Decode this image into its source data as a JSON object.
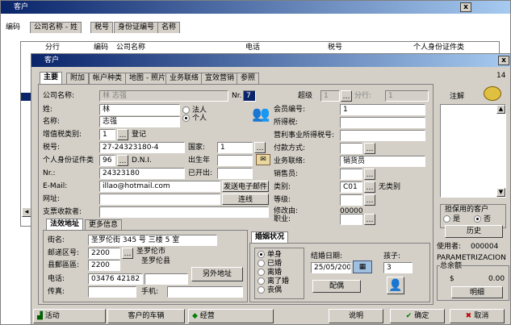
{
  "back_window": {
    "title": "客户",
    "close": "x",
    "search_label": "编码",
    "search_tabs": [
      "公司名称 - 姓",
      "税号",
      "身份证编号",
      "名称"
    ],
    "columns": [
      "分行",
      "编码",
      "公司名称",
      "电话",
      "税号",
      "个人身份证件类"
    ]
  },
  "front_window": {
    "title": "客户",
    "close": "x",
    "counter": "14",
    "tabs": [
      "主要",
      "附加",
      "帐户种类",
      "地图 - 照片",
      "业务联络",
      "宣效营销",
      "参照"
    ],
    "left": {
      "company_name_label": "公司名称:",
      "company_name_value": "林 志强",
      "nr_label": "Nr.",
      "nr_value": "7",
      "branch_mark": "超级",
      "branch_value": "1",
      "branch_label": "分行:",
      "branch_value2": "1",
      "surname_label": "姓:",
      "surname_value": "林",
      "name_label": "名称:",
      "name_value": "志强",
      "legal_person": "法人",
      "individual": "个人",
      "vat_type_label": "增值税类别:",
      "vat_type_value": "1",
      "vat_type_text": "登记",
      "tax_no_label": "税号:",
      "tax_no_value": "27-24323180-4",
      "country_label": "国家:",
      "country_value": "1",
      "id_type_label": "个人身份证件类",
      "id_type_value": "96",
      "id_type_text": "D.N.I.",
      "birth_label": "出生年",
      "nr2_label": "Nr.:",
      "nr2_value": "24323180",
      "issued_label": "已开出:",
      "email_label": "E-Mail:",
      "email_value": "illao@hotmail.com",
      "send_email_button": "发送电子邮件",
      "web_label": "网址:",
      "connect_button": "连线",
      "cheque_label": "支票收款者:"
    },
    "right": {
      "member_label": "会员编号:",
      "member_value": "1",
      "income_label": "所得税:",
      "nonprofit_label": "营利事业所得税号:",
      "payment_label": "付款方式:",
      "business_label": "业务联络:",
      "business_value": "销货员",
      "sales_label": "销售员:",
      "category_label": "类别:",
      "category_value": "C01",
      "category_text": "无类别",
      "grade_label": "等级:",
      "modified_label": "修改由:",
      "modified_value": "00000",
      "job_label": "职业:"
    },
    "address": {
      "tabs": [
        "法效地址",
        "更多信息"
      ],
      "street_label": "街名:",
      "street_value": "圣罗伦街 345 号 三楼 5 室",
      "zip_label": "邮递区号:",
      "zip_value": "2200",
      "city_text": "圣罗伦市",
      "area_label": "县郵區區:",
      "area_value": "2200",
      "area_text": "圣罗伦县",
      "phone_label": "电话:",
      "phone_value": "03476 42182",
      "fax_label": "传真:",
      "mobile_label": "手机:",
      "other_address_button": "另外地址"
    },
    "marital": {
      "title": "婚姻状况",
      "options": [
        "单身",
        "已婚",
        "离婚",
        "离了婚",
        "丧偶"
      ],
      "wedding_label": "结婚日期:",
      "wedding_value": "25/05/200",
      "children_label": "孩子:",
      "children_value": "3",
      "spouse_button": "配偶"
    },
    "side": {
      "note_label": "注解",
      "guarantee_title": "担保用的客户",
      "guarantee_yes": "是",
      "guarantee_no": "否",
      "history_button": "历史",
      "used_by_label": "使用者:",
      "used_by_value": "000004",
      "param_text": "PARAMETRIZACION",
      "total_label": "总余额",
      "currency": "$",
      "balance": "0.00",
      "detail_button": "明细"
    }
  },
  "bottom": {
    "activity": "活动",
    "vehicles": "客户的车辆",
    "operation": "经营",
    "help": "说明",
    "confirm": "确定",
    "cancel": "取消"
  }
}
